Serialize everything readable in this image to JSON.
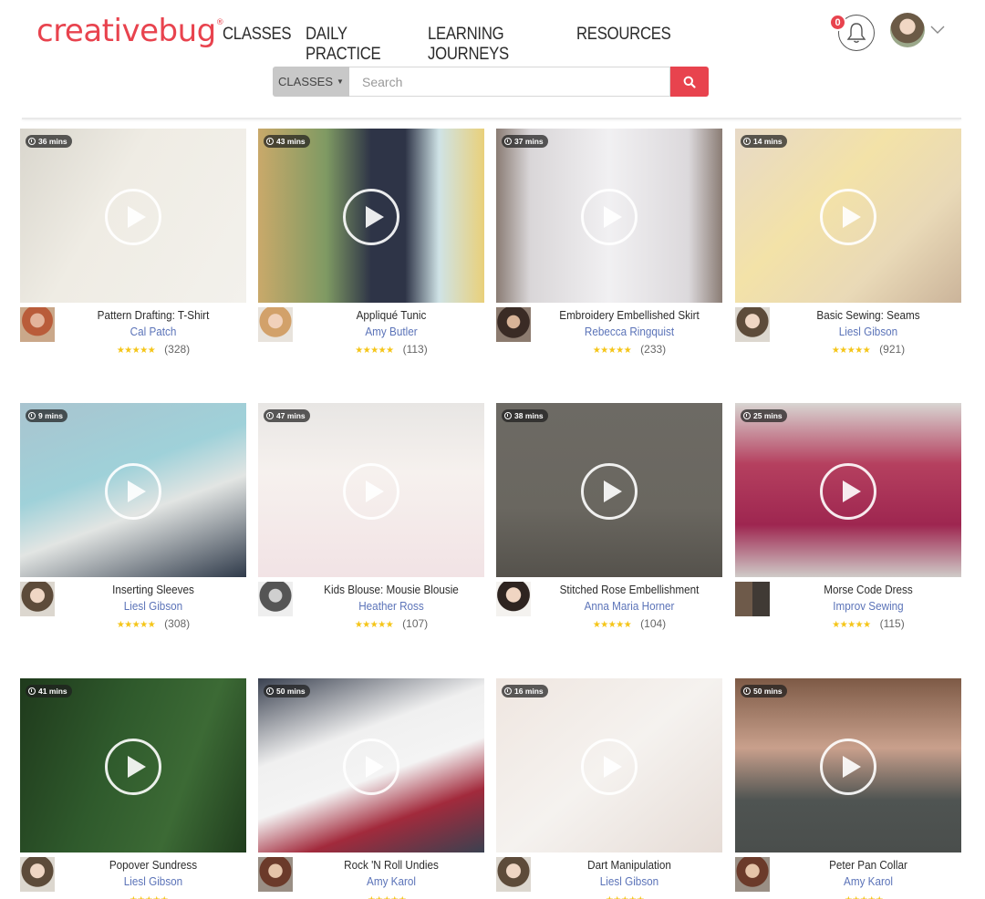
{
  "header": {
    "logo": "creativebug",
    "logo_mark": "®",
    "nav": [
      "CLASSES",
      "DAILY PRACTICE",
      "LEARNING JOURNEYS",
      "RESOURCES"
    ],
    "notifications_count": "0",
    "bell_icon": "bell-icon",
    "account_menu_icon": "chevron-down-icon"
  },
  "search": {
    "category": "CLASSES",
    "placeholder": "Search",
    "button_icon": "search-icon"
  },
  "colors": {
    "brand": "#e8434e",
    "author_link": "#5b73b8",
    "stars": "#f5c518"
  },
  "classes": [
    {
      "duration": "36 mins",
      "title": "Pattern Drafting: T-Shirt",
      "author": "Cal Patch",
      "rating_count": "(328)",
      "stars": "★★★★★"
    },
    {
      "duration": "43 mins",
      "title": "Appliqué Tunic",
      "author": "Amy Butler",
      "rating_count": "(113)",
      "stars": "★★★★★"
    },
    {
      "duration": "37 mins",
      "title": "Embroidery Embellished Skirt",
      "author": "Rebecca Ringquist",
      "rating_count": "(233)",
      "stars": "★★★★★"
    },
    {
      "duration": "14 mins",
      "title": "Basic Sewing: Seams",
      "author": "Liesl Gibson",
      "rating_count": "(921)",
      "stars": "★★★★★"
    },
    {
      "duration": "9 mins",
      "title": "Inserting Sleeves",
      "author": "Liesl Gibson",
      "rating_count": "(308)",
      "stars": "★★★★★"
    },
    {
      "duration": "47 mins",
      "title": "Kids Blouse: Mousie Blousie",
      "author": "Heather Ross",
      "rating_count": "(107)",
      "stars": "★★★★★"
    },
    {
      "duration": "38 mins",
      "title": "Stitched Rose Embellishment",
      "author": "Anna Maria Horner",
      "rating_count": "(104)",
      "stars": "★★★★★"
    },
    {
      "duration": "25 mins",
      "title": "Morse Code Dress",
      "author": "Improv Sewing",
      "rating_count": "(115)",
      "stars": "★★★★★"
    },
    {
      "duration": "41 mins",
      "title": "Popover Sundress",
      "author": "Liesl Gibson",
      "rating_count": "",
      "stars": "★★★★★"
    },
    {
      "duration": "50 mins",
      "title": "Rock 'N Roll Undies",
      "author": "Amy Karol",
      "rating_count": "",
      "stars": "★★★★★"
    },
    {
      "duration": "16 mins",
      "title": "Dart Manipulation",
      "author": "Liesl Gibson",
      "rating_count": "",
      "stars": "★★★★★"
    },
    {
      "duration": "50 mins",
      "title": "Peter Pan Collar",
      "author": "Amy Karol",
      "rating_count": "",
      "stars": "★★★★★"
    }
  ]
}
